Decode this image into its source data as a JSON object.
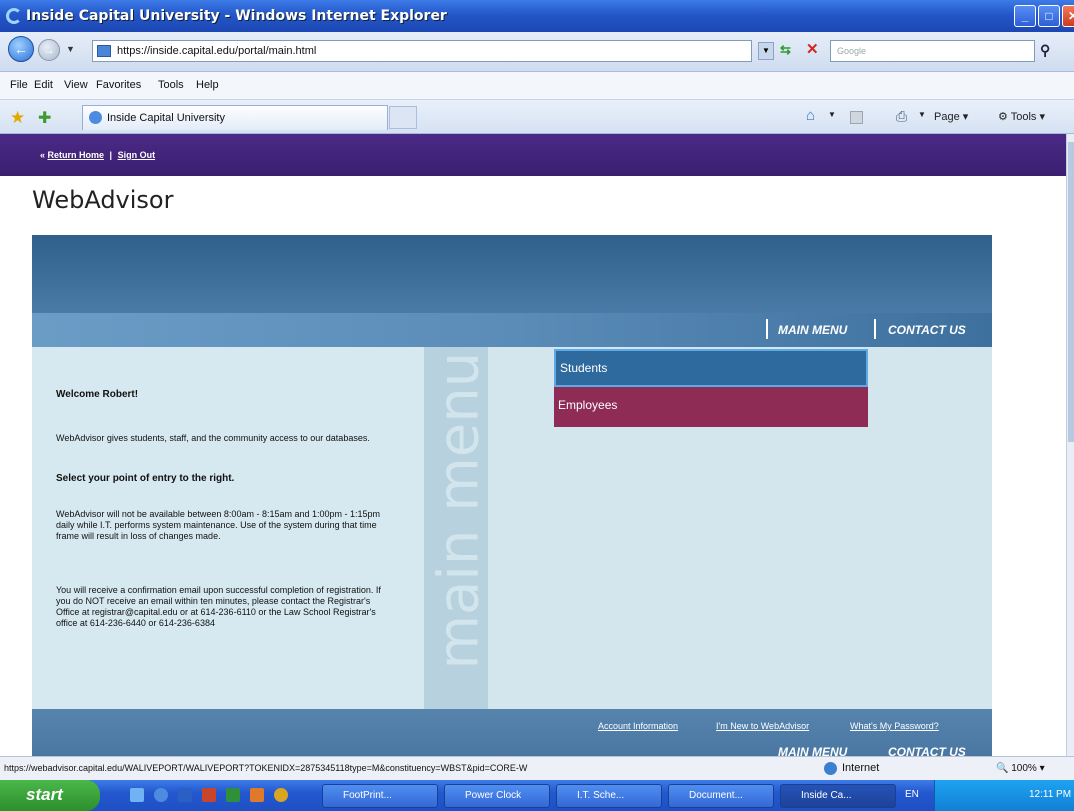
{
  "window": {
    "title": "Inside Capital University - Windows Internet Explorer"
  },
  "address": {
    "url": "https://inside.capital.edu/portal/main.html",
    "search_placeholder": "Google"
  },
  "menubar": [
    "File",
    "Edit",
    "View",
    "Favorites",
    "Tools",
    "Help"
  ],
  "favbar": {
    "tab_label": "Inside Capital University",
    "page_label": "Page",
    "tools_label": "Tools"
  },
  "portal": {
    "return_home": "Return Home",
    "separator": "|",
    "sign_out": "Sign Out",
    "heading": "WebAdvisor"
  },
  "webadvisor": {
    "top_nav": {
      "main_menu": "MAIN MENU",
      "contact_us": "CONTACT US"
    },
    "watermark": "main menu",
    "welcome": "Welcome Robert!",
    "intro": "WebAdvisor gives students, staff, and the community access to our databases.",
    "select_prompt": "Select your point of entry to the right.",
    "maintenance": "WebAdvisor will not be available between 8:00am - 8:15am and 1:00pm - 1:15pm daily while I.T. performs system maintenance. Use of the system during that time frame will result in loss of changes made.",
    "confirmation": "You will receive a confirmation email upon successful completion of registration. If you do NOT receive an email within ten minutes, please contact the Registrar's Office at registrar@capital.edu or at 614-236-6110 or the Law School Registrar's office at 614-236-6440 or 614-236-6384",
    "menu": {
      "students": "Students",
      "employees": "Employees"
    },
    "footer_links": {
      "account_info": "Account Information",
      "new_user": "I'm New to WebAdvisor",
      "password": "What's My Password?"
    },
    "footer_nav": {
      "main_menu": "MAIN MENU",
      "contact_us": "CONTACT US"
    }
  },
  "statusbar": {
    "url": "https://webadvisor.capital.edu/WALIVEPORT/WALIVEPORT?TOKENIDX=2875345118type=M&constituency=WBST&pid=CORE-W",
    "zone": "Internet",
    "zoom": "100%"
  },
  "taskbar": {
    "start": "start",
    "tasks": [
      "FootPrint...",
      "Power Clock",
      "I.T. Sche...",
      "Document...",
      "Inside Ca..."
    ],
    "lang": "EN",
    "clock": "12:11 PM"
  },
  "colors": {
    "portal_purple": "#3a1f70",
    "students": "#2f6a9e",
    "employees": "#8e2c55"
  }
}
